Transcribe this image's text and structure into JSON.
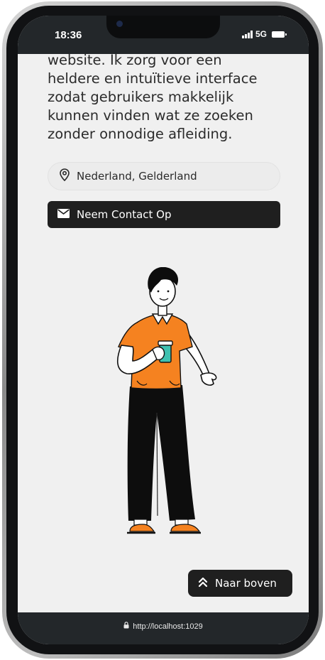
{
  "status_bar": {
    "time": "18:36",
    "network": "5G"
  },
  "main": {
    "bio_text": "website. Ik zorg voor een\nheldere en intuïtieve interface\nzodat gebruikers makkelijk\nkunnen vinden wat ze zoeken\nzonder onnodige afleiding.",
    "location": {
      "icon": "map-pin-icon",
      "label": "Nederland, Gelderland"
    },
    "contact_button": {
      "icon": "mail-icon",
      "label": "Neem Contact Op"
    },
    "back_to_top_button": {
      "icon": "double-chevron-up-icon",
      "label": "Naar boven"
    }
  },
  "browser": {
    "url": "http://localhost:1029",
    "lock_icon": "lock-icon"
  },
  "colors": {
    "page_bg": "#f0f0f0",
    "dark": "#1f1f1f",
    "accent_orange": "#f58220",
    "cup_teal": "#3fc1b0"
  }
}
